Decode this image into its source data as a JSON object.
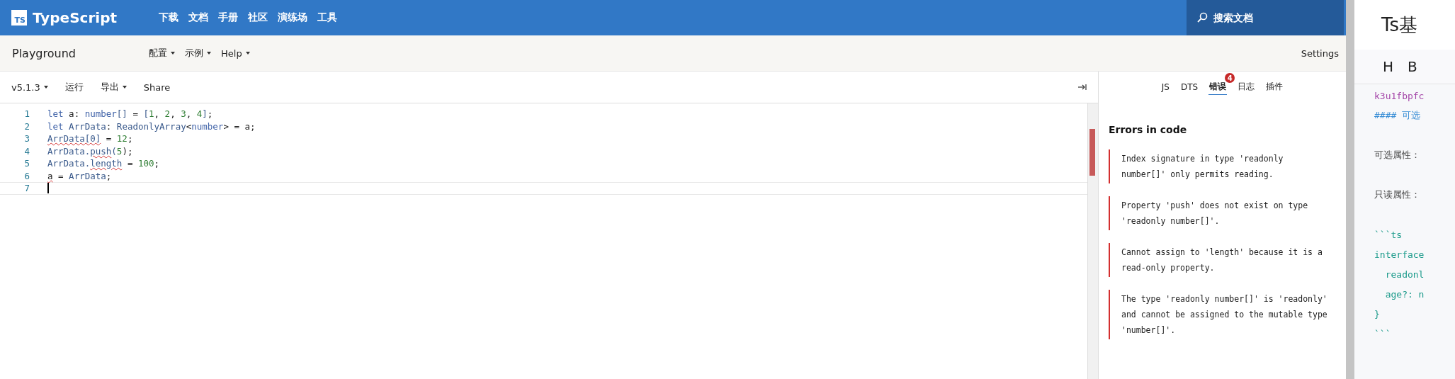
{
  "site_header": {
    "logo_badge": "TS",
    "logo_text": "TypeScript",
    "nav": [
      "下载",
      "文档",
      "手册",
      "社区",
      "演练场",
      "工具"
    ],
    "search": {
      "placeholder": "搜索文档"
    }
  },
  "subheader": {
    "title": "Playground",
    "menus": [
      {
        "label": "配置",
        "dropdown": true
      },
      {
        "label": "示例",
        "dropdown": true
      },
      {
        "label": "Help",
        "dropdown": true
      }
    ],
    "settings": "Settings"
  },
  "toolbar": [
    {
      "label": "v5.1.3",
      "dropdown": true
    },
    {
      "label": "运行",
      "dropdown": false
    },
    {
      "label": "导出",
      "dropdown": true
    },
    {
      "label": "Share",
      "dropdown": false
    }
  ],
  "editor": {
    "lines": [
      {
        "number": "1",
        "current": false,
        "tokens": [
          {
            "text": "let ",
            "kind": "keyword",
            "error": false
          },
          {
            "text": "a: ",
            "kind": "plain",
            "error": false
          },
          {
            "text": "number",
            "kind": "keyword",
            "error": false
          },
          {
            "text": "[]",
            "kind": "type",
            "error": false
          },
          {
            "text": " = ",
            "kind": "plain",
            "error": false
          },
          {
            "text": "[",
            "kind": "type",
            "error": false
          },
          {
            "text": "1",
            "kind": "number",
            "error": false
          },
          {
            "text": ", ",
            "kind": "plain",
            "error": false
          },
          {
            "text": "2",
            "kind": "number",
            "error": false
          },
          {
            "text": ", ",
            "kind": "plain",
            "error": false
          },
          {
            "text": "3",
            "kind": "number",
            "error": false
          },
          {
            "text": ", ",
            "kind": "plain",
            "error": false
          },
          {
            "text": "4",
            "kind": "number",
            "error": false
          },
          {
            "text": "]",
            "kind": "type",
            "error": false
          },
          {
            "text": ";",
            "kind": "plain",
            "error": false
          }
        ]
      },
      {
        "number": "2",
        "current": false,
        "tokens": [
          {
            "text": "let ",
            "kind": "keyword",
            "error": false
          },
          {
            "text": "ArrData",
            "kind": "type",
            "error": false
          },
          {
            "text": ": ",
            "kind": "plain",
            "error": false
          },
          {
            "text": "ReadonlyArray",
            "kind": "type",
            "error": false
          },
          {
            "text": "<",
            "kind": "plain",
            "error": false
          },
          {
            "text": "number",
            "kind": "keyword",
            "error": false
          },
          {
            "text": "> = a;",
            "kind": "plain",
            "error": false
          }
        ]
      },
      {
        "number": "3",
        "current": false,
        "tokens": [
          {
            "text": "ArrData[0]",
            "kind": "type",
            "error": true
          },
          {
            "text": " = ",
            "kind": "plain",
            "error": false
          },
          {
            "text": "12",
            "kind": "number",
            "error": false
          },
          {
            "text": ";",
            "kind": "plain",
            "error": false
          }
        ]
      },
      {
        "number": "4",
        "current": false,
        "tokens": [
          {
            "text": "ArrData.",
            "kind": "type",
            "error": false
          },
          {
            "text": "push",
            "kind": "type",
            "error": true
          },
          {
            "text": "(",
            "kind": "type",
            "error": false
          },
          {
            "text": "5",
            "kind": "number",
            "error": false
          },
          {
            "text": ");",
            "kind": "plain",
            "error": false
          }
        ]
      },
      {
        "number": "5",
        "current": false,
        "tokens": [
          {
            "text": "ArrData.",
            "kind": "type",
            "error": false
          },
          {
            "text": "length",
            "kind": "type",
            "error": true
          },
          {
            "text": " = ",
            "kind": "plain",
            "error": false
          },
          {
            "text": "100",
            "kind": "number",
            "error": false
          },
          {
            "text": ";",
            "kind": "plain",
            "error": false
          }
        ]
      },
      {
        "number": "6",
        "current": false,
        "tokens": [
          {
            "text": "a",
            "kind": "plain",
            "error": true
          },
          {
            "text": " = ",
            "kind": "plain",
            "error": false
          },
          {
            "text": "ArrData",
            "kind": "type",
            "error": false
          },
          {
            "text": ";",
            "kind": "plain",
            "error": false
          }
        ]
      },
      {
        "number": "7",
        "current": true
      }
    ]
  },
  "sidebar": {
    "tabs": [
      {
        "label": "JS",
        "selected": false
      },
      {
        "label": "DTS",
        "selected": false
      },
      {
        "label": "错误",
        "selected": true,
        "badge": "4"
      },
      {
        "label": "日志",
        "selected": false
      },
      {
        "label": "插件",
        "selected": false
      }
    ],
    "heading": "Errors in code",
    "errors": [
      "Index signature in type 'readonly number[]' only permits reading.",
      "Property 'push' does not exist on type 'readonly number[]'.",
      "Cannot assign to 'length' because it is a read-only property.",
      "The type 'readonly number[]' is 'readonly' and cannot be assigned to the mutable type 'number[]'."
    ]
  },
  "side_document": {
    "title": "Ts基",
    "toolbar": [
      "H",
      "B"
    ],
    "lines": [
      {
        "text": "k3u1fbpfc",
        "kind": "link"
      },
      {
        "text": "#### 可选",
        "kind": "heading"
      },
      {
        "kind": "blank"
      },
      {
        "text": "可选属性：",
        "kind": "text"
      },
      {
        "kind": "blank"
      },
      {
        "text": "只读属性：",
        "kind": "text"
      },
      {
        "kind": "blank"
      },
      {
        "text": "```ts",
        "kind": "code"
      },
      {
        "text": "interface",
        "kind": "code"
      },
      {
        "text": "  readonl",
        "kind": "code"
      },
      {
        "text": "  age?: n",
        "kind": "code"
      },
      {
        "text": "}",
        "kind": "code"
      },
      {
        "text": "```",
        "kind": "code"
      }
    ]
  }
}
